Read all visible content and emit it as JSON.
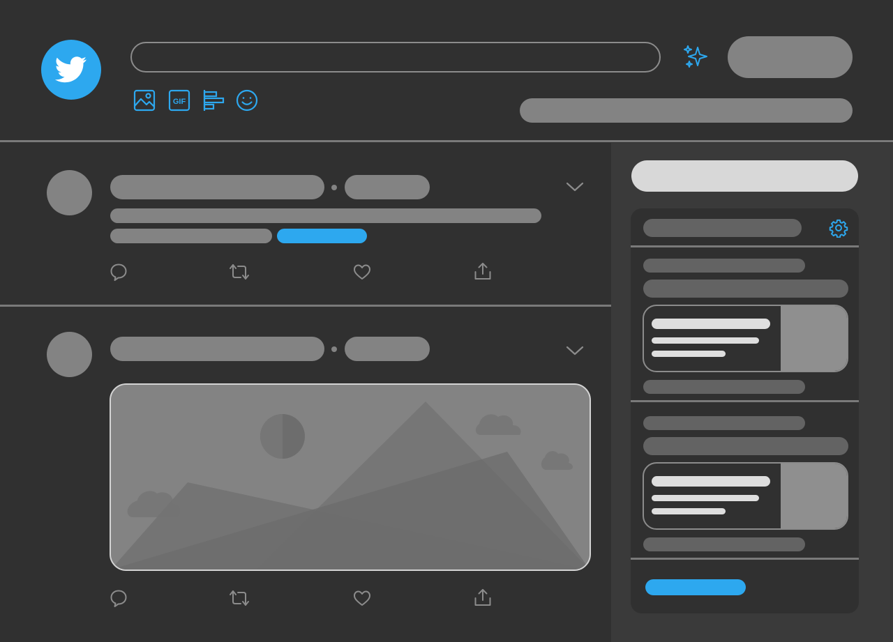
{
  "app": {
    "brand": "twitter-bird-icon",
    "accent_color": "#2da8ef",
    "background_color": "#303030"
  },
  "composer": {
    "input_value": "",
    "tools": [
      "image-icon",
      "gif-icon",
      "poll-icon",
      "emoji-icon"
    ],
    "gif_label": "GIF",
    "sparkle_icon": "sparkle-icon"
  },
  "tweets": [
    {
      "actions": [
        "reply-icon",
        "retweet-icon",
        "like-icon",
        "share-icon"
      ],
      "menu_icon": "chevron-down-icon",
      "has_link": true
    },
    {
      "actions": [
        "reply-icon",
        "retweet-icon",
        "like-icon",
        "share-icon"
      ],
      "menu_icon": "chevron-down-icon",
      "has_media": true
    }
  ],
  "sidebar": {
    "settings_icon": "gear-icon",
    "trend_cards": 2
  }
}
